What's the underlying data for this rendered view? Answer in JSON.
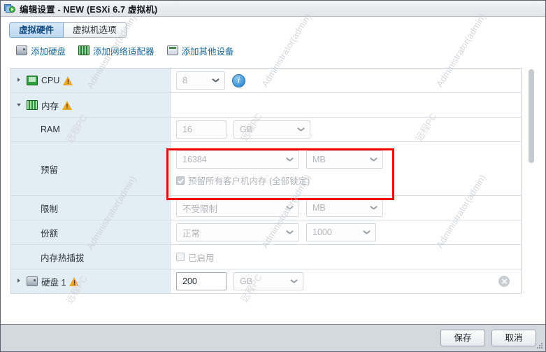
{
  "window": {
    "title": "编辑设置 - NEW (ESXi 6.7 虚拟机)",
    "icon": "virtual-machine-icon"
  },
  "tabs": [
    {
      "label": "虚拟硬件",
      "active": true
    },
    {
      "label": "虚拟机选项",
      "active": false
    }
  ],
  "toolbar": [
    {
      "label": "添加硬盘",
      "icon": "hard-disk-icon"
    },
    {
      "label": "添加网络适配器",
      "icon": "network-adapter-icon"
    },
    {
      "label": "添加其他设备",
      "icon": "other-device-icon"
    }
  ],
  "rows": {
    "cpu": {
      "label": "CPU",
      "value": "8",
      "warning": "warning-icon",
      "info": "info-icon"
    },
    "memory": {
      "label": "内存",
      "warning": "warning-icon"
    },
    "ram": {
      "label": "RAM",
      "value": "16",
      "unit": "GB"
    },
    "reservation": {
      "label": "预留",
      "value": "16384",
      "unit": "MB",
      "checkbox_label": "预留所有客户机内存 (全部锁定)",
      "checkbox_checked": true
    },
    "limit": {
      "label": "限制",
      "value": "不受限制",
      "unit": "MB"
    },
    "shares": {
      "label": "份额",
      "value": "正常",
      "amount": "1000"
    },
    "hotplug": {
      "label": "内存热插拔",
      "checkbox_label": "已启用",
      "checkbox_checked": false
    },
    "harddisk1": {
      "label": "硬盘 1",
      "value": "200",
      "unit": "GB",
      "warning": "warning-icon",
      "remove": "remove-icon"
    }
  },
  "footer": {
    "save_label": "保存",
    "cancel_label": "取消"
  },
  "watermarks": {
    "line1": "Administrator(admin)",
    "line2": "远程PC"
  },
  "colors": {
    "highlight": "#f40000",
    "label_column": "#e3edf4",
    "accent": "#15699e",
    "warning": "#e8a92a"
  }
}
